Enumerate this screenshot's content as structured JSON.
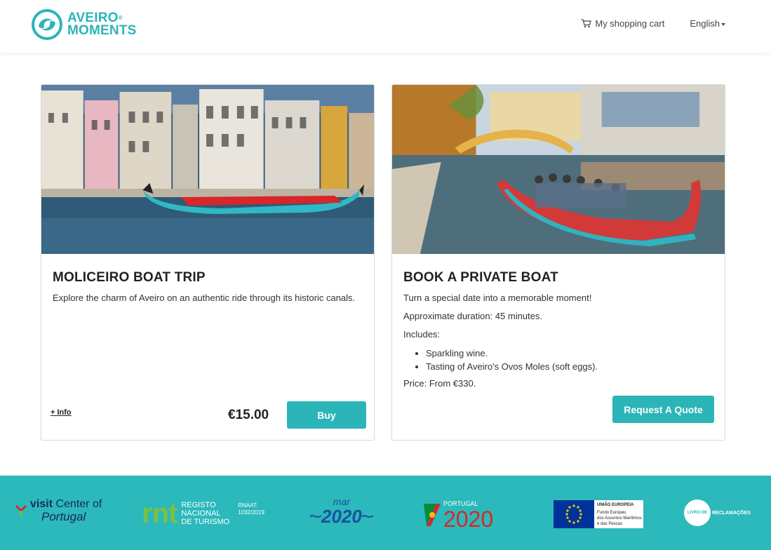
{
  "header": {
    "logo_line1": "AVEIRO",
    "logo_reg": "®",
    "logo_line2": "MOMENTS",
    "cart_label": "My shopping cart",
    "language_label": "English",
    "cart_icon": "cart-icon"
  },
  "cards": [
    {
      "title": "MOLICEIRO BOAT TRIP",
      "description": "Explore the charm of Aveiro on an authentic ride through its historic canals.",
      "more_info": "+ Info",
      "price": "€15.00",
      "button": "Buy"
    },
    {
      "title": "BOOK A PRIVATE BOAT",
      "paragraphs": [
        "Turn a special date into a memorable moment!",
        "Approximate duration: 45 minutes.",
        "Includes:"
      ],
      "includes": [
        "Sparkling wine.",
        "Tasting of Aveiro's Ovos Moles (soft eggs)."
      ],
      "price_line": "Price: From €330.",
      "button": "Request A Quote"
    }
  ],
  "footer": {
    "visit_top": "visit",
    "visit_center": "Center of",
    "visit_bottom": "Portugal",
    "rnt_big": "rnt",
    "rnt_line1": "REGISTO",
    "rnt_line2": "NACIONAL",
    "rnt_line3": "DE TURISMO",
    "rnaat_line1": "RNAAT:",
    "rnaat_line2": "1032/2019",
    "mar_top": "mar",
    "mar_year": "2020",
    "pt_small": "PORTUGAL",
    "pt_year": "2020",
    "eu_title": "UNIÃO EUROPEIA",
    "eu_line1": "Fundo Europeu",
    "eu_line2": "dos Assuntos Marítimos",
    "eu_line3": "e das Pescas",
    "livro_line1": "LIVRO DE",
    "livro_line2": "RECLAMAÇÕES"
  },
  "colors": {
    "accent": "#2bb5b8",
    "footer_bg": "#2bb9bb"
  }
}
